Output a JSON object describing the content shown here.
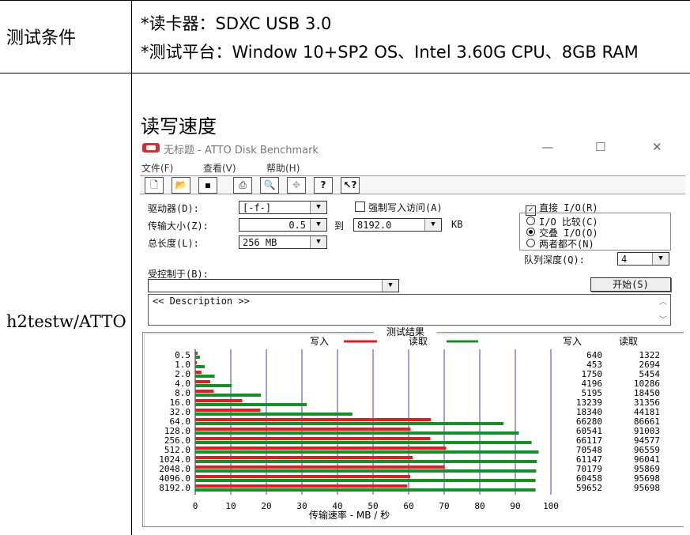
{
  "table": {
    "row1_label": "测试条件",
    "spec_line1": "*读卡器：SDXC USB 3.0",
    "spec_line2": "*测试平台：Window 10+SP2 OS、Intel 3.60G CPU、8GB RAM",
    "row2_label": "h2testw/ATTO",
    "section_title": "读写速度"
  },
  "window": {
    "title": "无标题 - ATTO Disk Benchmark",
    "controls": [
      "—",
      "☐",
      "✕"
    ]
  },
  "menu": [
    "文件(F)",
    "查看(V)",
    "帮助(H)"
  ],
  "toolbar_icons": [
    "new-icon",
    "open-icon",
    "save-icon",
    "print-icon",
    "print-preview-icon",
    "move-icon",
    "help-icon",
    "context-help-icon"
  ],
  "form": {
    "drive_label": "驱动器(D):",
    "drive_value": "[-f-]",
    "force_write_label": "强制写入访问(A)",
    "force_write_checked": false,
    "transfer_label": "传输大小(Z):",
    "transfer_from": "0.5",
    "to_label": "到",
    "transfer_to": "8192.0",
    "kb_label": "KB",
    "length_label": "总长度(L):",
    "length_value": "256 MB",
    "direct_io_label": "直接 I/O(R)",
    "direct_io_checked": true,
    "radio_options": [
      "I/O 比较(C)",
      "交叠 I/O(O)",
      "两者都不(N)"
    ],
    "radio_selected": 1,
    "queue_label": "队列深度(Q):",
    "queue_value": "4",
    "controlled_label": "受控制于(B):",
    "controlled_value": "",
    "start_button": "开始(S)",
    "description": "<< Description >>"
  },
  "chart_data": {
    "type": "bar",
    "title": "测试结果",
    "legend": [
      {
        "name": "写入",
        "color": "#e02020"
      },
      {
        "name": "读取",
        "color": "#1a8c2a"
      }
    ],
    "categories": [
      "0.5",
      "1.0",
      "2.0",
      "4.0",
      "8.0",
      "16.0",
      "32.0",
      "64.0",
      "128.0",
      "256.0",
      "512.0",
      "1024.0",
      "2048.0",
      "4096.0",
      "8192.0"
    ],
    "series": [
      {
        "name": "写入",
        "values": [
          640,
          453,
          1750,
          4196,
          5195,
          13239,
          18340,
          66280,
          60541,
          66117,
          70548,
          61147,
          70179,
          60458,
          59652
        ]
      },
      {
        "name": "读取",
        "values": [
          1322,
          2694,
          5454,
          10286,
          18450,
          31356,
          44181,
          86661,
          91003,
          94577,
          96559,
          96041,
          95869,
          95698,
          95698
        ]
      }
    ],
    "column_headers": [
      "写入",
      "读取"
    ],
    "x_ticks": [
      "0",
      "10",
      "20",
      "30",
      "40",
      "50",
      "60",
      "70",
      "80",
      "90",
      "100"
    ],
    "xlabel": "传输速率 - MB / 秒",
    "xlim": [
      0,
      100
    ],
    "grid": true,
    "colors": {
      "write": "#e02020",
      "read": "#1a8c2a",
      "grid": "#4040c0"
    }
  }
}
